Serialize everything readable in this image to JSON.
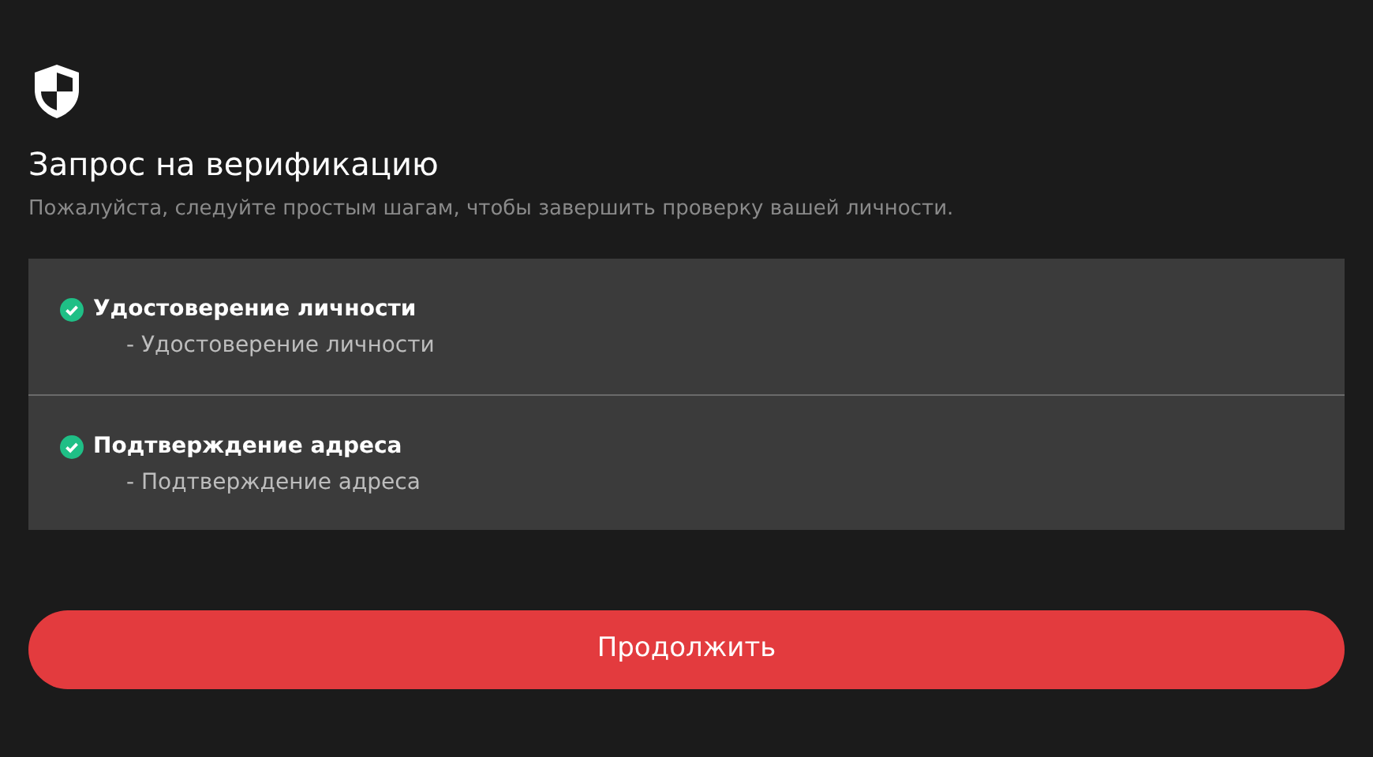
{
  "title": "Запрос на верификацию",
  "subtitle": "Пожалуйста, следуйте простым шагам, чтобы завершить проверку вашей личности.",
  "steps": [
    {
      "title": "Удостоверение личности",
      "detail": "- Удостоверение личности",
      "done": true
    },
    {
      "title": "Подтверждение адреса",
      "detail": "- Подтверждение адреса",
      "done": true
    }
  ],
  "button": "Продолжить"
}
